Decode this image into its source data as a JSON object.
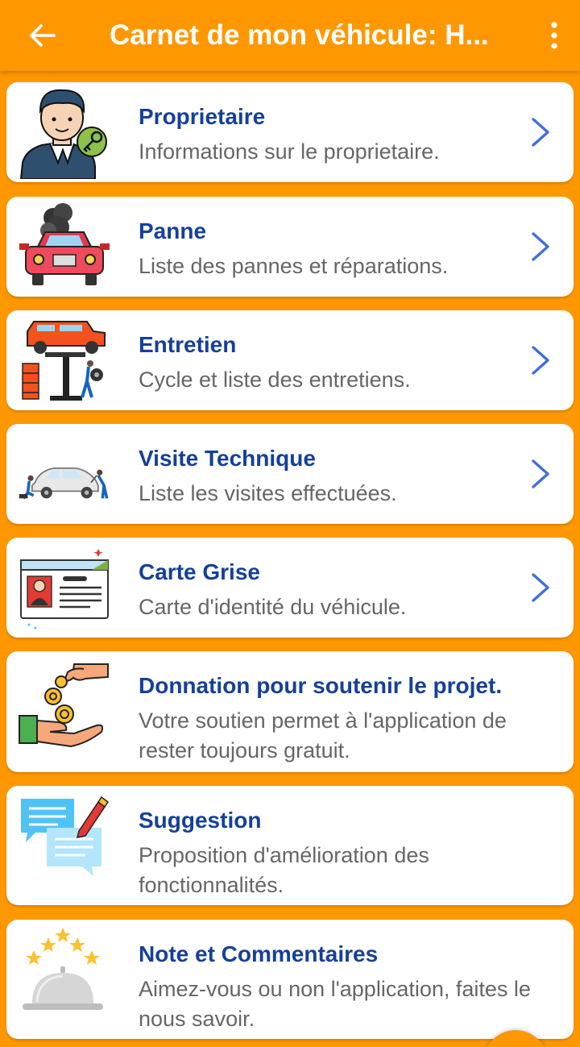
{
  "appbar": {
    "title": "Carnet de mon véhicule: H...",
    "back_icon": "arrow-left-icon",
    "menu_icon": "more-vertical-icon"
  },
  "colors": {
    "accent": "#FF9800",
    "title_text": "#15409a",
    "subtitle_text": "#666666",
    "chevron": "#3F6FD8"
  },
  "items": [
    {
      "title": "Proprietaire",
      "subtitle": "Informations sur le proprietaire.",
      "icon": "owner-icon",
      "has_chevron": true
    },
    {
      "title": "Panne",
      "subtitle": "Liste des pannes et réparations.",
      "icon": "broken-car-icon",
      "has_chevron": true
    },
    {
      "title": "Entretien",
      "subtitle": "Cycle et liste des entretiens.",
      "icon": "car-lift-icon",
      "has_chevron": true
    },
    {
      "title": "Visite Technique",
      "subtitle": "Liste les visites effectuées.",
      "icon": "car-inspection-icon",
      "has_chevron": true
    },
    {
      "title": "Carte Grise",
      "subtitle": "Carte d'identité du véhicule.",
      "icon": "id-card-icon",
      "has_chevron": true
    },
    {
      "title": "Donnation pour soutenir le projet.",
      "subtitle": "Votre soutien permet à l'application de rester toujours gratuit.",
      "icon": "donation-icon",
      "has_chevron": false
    },
    {
      "title": "Suggestion",
      "subtitle": "Proposition d'amélioration des fonctionnalités.",
      "icon": "chat-pencil-icon",
      "has_chevron": false
    },
    {
      "title": "Note et Commentaires",
      "subtitle": "Aimez-vous ou non l'application, faites le nous savoir.",
      "icon": "rating-bell-icon",
      "has_chevron": false
    }
  ]
}
